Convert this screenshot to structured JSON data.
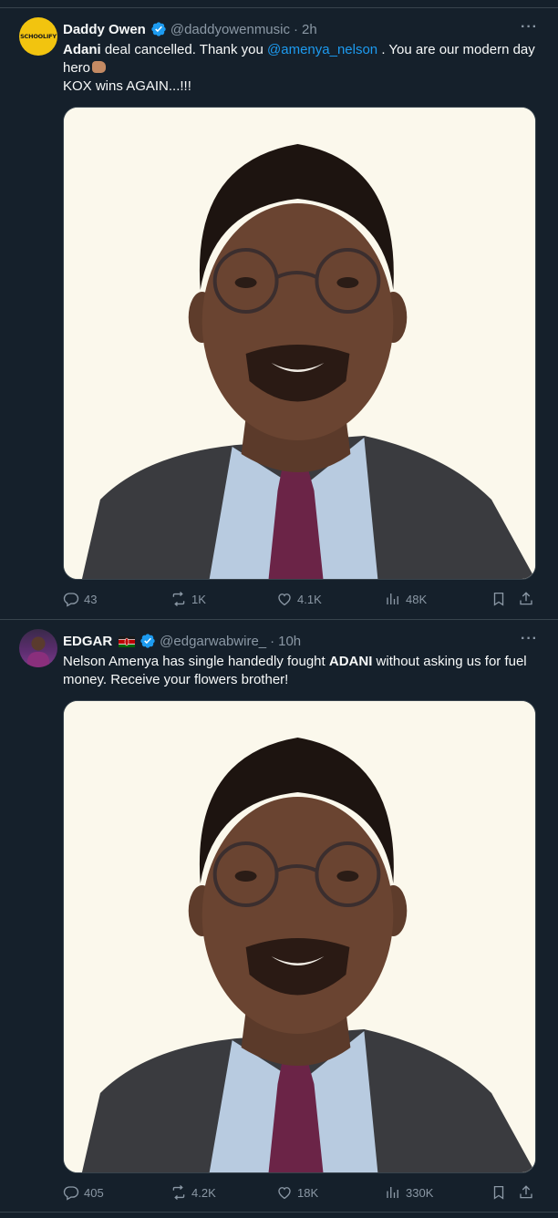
{
  "tweets": [
    {
      "avatar_text": "SCHOOLIFY",
      "name": "Daddy Owen",
      "handle": "@daddyowenmusic",
      "sep": "·",
      "time": "2h",
      "more": "···",
      "text": {
        "bold1": "Adani",
        "part1": " deal cancelled.  Thank you ",
        "mention": "@amenya_nelson",
        "part2": " . You are our modern day hero",
        "line2": "KOX wins AGAIN...!!!"
      },
      "stats": {
        "replies": "43",
        "retweets": "1K",
        "likes": "4.1K",
        "views": "48K"
      }
    },
    {
      "name": "EDGAR",
      "handle": "@edgarwabwire_",
      "sep": "·",
      "time": "10h",
      "more": "···",
      "text": {
        "part1": "Nelson Amenya has single handedly fought ",
        "bold1": "ADANI",
        "part2": " without asking us for fuel money. Receive your flowers brother!"
      },
      "stats": {
        "replies": "405",
        "retweets": "4.2K",
        "likes": "18K",
        "views": "330K"
      }
    }
  ],
  "icons": {
    "reply": "reply-icon",
    "retweet": "retweet-icon",
    "like": "heart-icon",
    "views": "views-icon",
    "bookmark": "bookmark-icon",
    "share": "share-icon",
    "verified": "verified-badge-icon",
    "flag": "kenya-flag-icon",
    "emoji": "fist-bump-emoji"
  },
  "colors": {
    "background": "#15202b",
    "accent": "#1d9bf0",
    "muted": "#8b98a5",
    "border": "#38444d"
  }
}
